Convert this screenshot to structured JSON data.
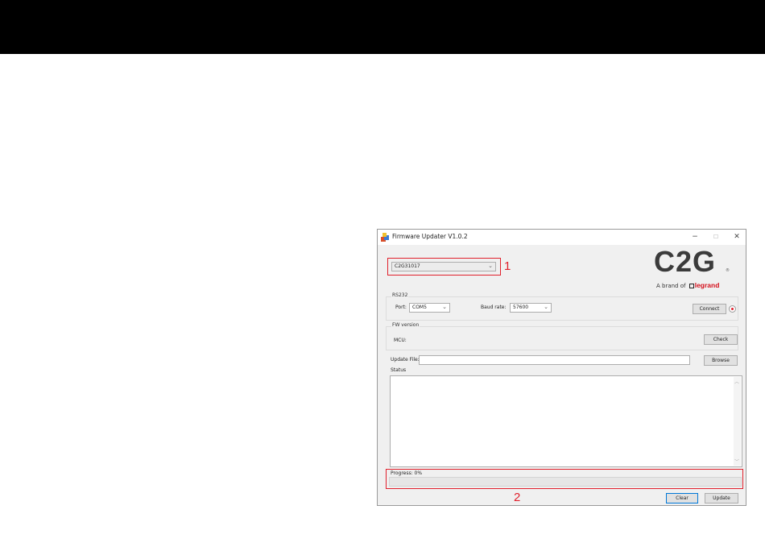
{
  "window": {
    "title": "Firmware Updater V1.0.2",
    "controls": {
      "minimize": "−",
      "maximize": "☐",
      "close": "✕"
    }
  },
  "device_select": {
    "value": "C2G31017"
  },
  "annotations": {
    "label_1": "1",
    "label_2": "2",
    "color": "#e0202c"
  },
  "logo": {
    "text": "C2G",
    "registered": "®",
    "tagline_prefix": "A brand of",
    "brand": "legrand",
    "brand_color": "#d4101c"
  },
  "rs232": {
    "title": "RS232",
    "port_label": "Port:",
    "port_value": "COM5",
    "baud_label": "Baud rate:",
    "baud_value": "57600",
    "connect_label": "Connect",
    "connected": false
  },
  "fw_version": {
    "title": "FW version",
    "mcu_label": "MCU:",
    "mcu_value": "",
    "check_label": "Check"
  },
  "update_file": {
    "label": "Update File:",
    "value": "",
    "browse_label": "Browse"
  },
  "status": {
    "label": "Status",
    "text": ""
  },
  "progress": {
    "label": "Progress: 0%",
    "percent": 0
  },
  "actions": {
    "clear_label": "Clear",
    "update_label": "Update"
  }
}
